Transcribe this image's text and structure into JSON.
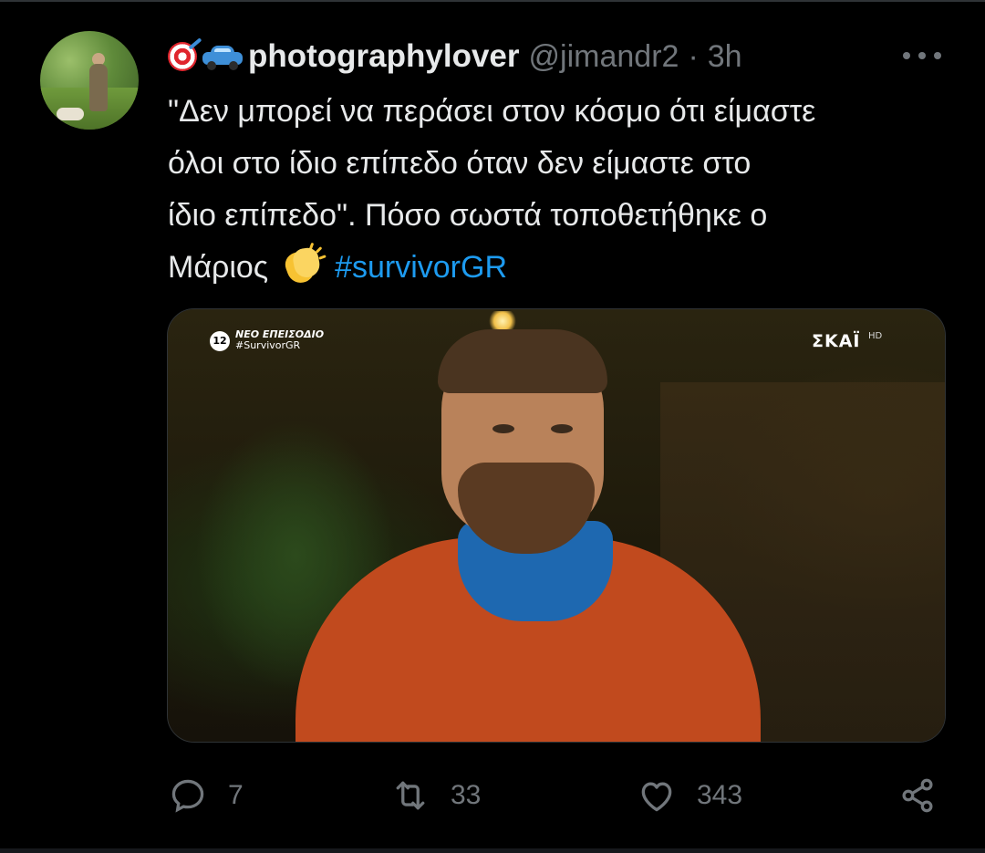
{
  "tweet": {
    "author": {
      "display_name": "photographylover",
      "emoji_prefix": [
        "direct-hit-emoji",
        "car-emoji"
      ],
      "handle": "@jimandr2",
      "separator": "·",
      "time": "3h"
    },
    "text_lines": [
      "\"Δεν μπορεί να περάσει στον κόσμο ότι είμαστε",
      "όλοι στο ίδιο επίπεδο όταν δεν είμαστε στο",
      "ίδιο επίπεδο\". Πόσο σωστά τοποθετήθηκε ο",
      "Μάριος"
    ],
    "hashtag": "#survivorGR",
    "media": {
      "overlay_badge": "12",
      "overlay_line1": "ΝΕΟ ΕΠΕΙΣΟΔΙΟ",
      "overlay_line2": "#SurvivorGR",
      "channel_brand": "ΣΚΑΪ",
      "channel_hd": "HD"
    },
    "stats": {
      "replies": "7",
      "retweets": "33",
      "likes": "343"
    }
  },
  "colors": {
    "background": "#000000",
    "text_primary": "#e7e9ea",
    "text_secondary": "#71767b",
    "link": "#1d9bf0",
    "border": "#2f3336"
  }
}
